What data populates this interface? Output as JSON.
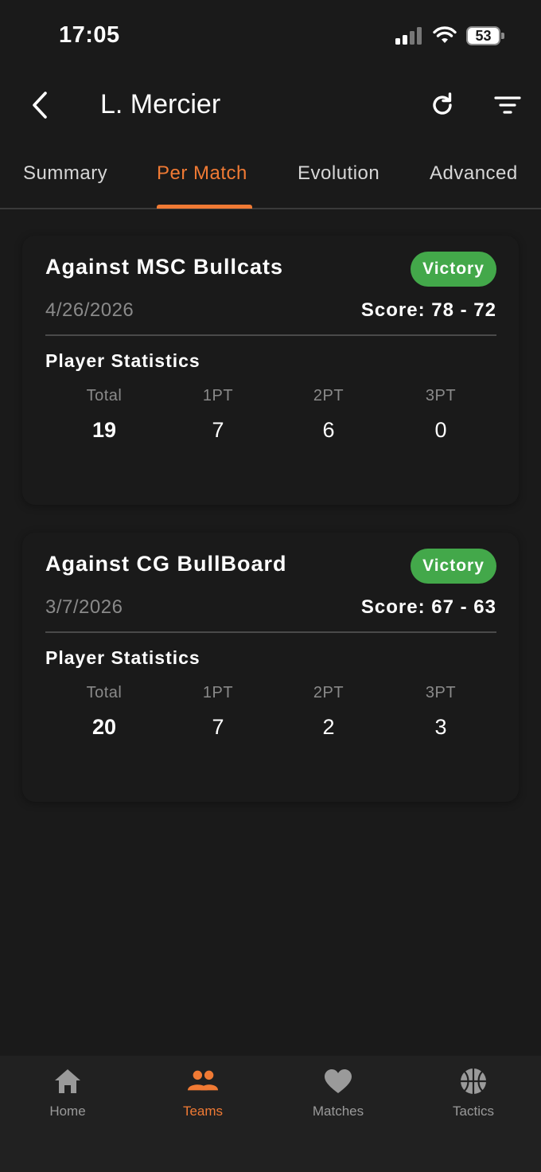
{
  "status_bar": {
    "time": "17:05",
    "battery": "53"
  },
  "header": {
    "title": "L. Mercier"
  },
  "tabs": [
    {
      "label": "Summary",
      "active": false
    },
    {
      "label": "Per Match",
      "active": true
    },
    {
      "label": "Evolution",
      "active": false
    },
    {
      "label": "Advanced",
      "active": false
    }
  ],
  "matches": [
    {
      "opponent": "Against MSC Bullcats",
      "result": "Victory",
      "date": "4/26/2026",
      "score": "Score: 78 - 72",
      "stats_title": "Player Statistics",
      "stats": [
        {
          "label": "Total",
          "value": "19"
        },
        {
          "label": "1PT",
          "value": "7"
        },
        {
          "label": "2PT",
          "value": "6"
        },
        {
          "label": "3PT",
          "value": "0"
        }
      ]
    },
    {
      "opponent": "Against CG BullBoard",
      "result": "Victory",
      "date": "3/7/2026",
      "score": "Score: 67 - 63",
      "stats_title": "Player Statistics",
      "stats": [
        {
          "label": "Total",
          "value": "20"
        },
        {
          "label": "1PT",
          "value": "7"
        },
        {
          "label": "2PT",
          "value": "2"
        },
        {
          "label": "3PT",
          "value": "3"
        }
      ]
    }
  ],
  "bottom_nav": [
    {
      "label": "Home",
      "icon": "home-icon",
      "active": false
    },
    {
      "label": "Teams",
      "icon": "teams-icon",
      "active": true
    },
    {
      "label": "Matches",
      "icon": "heart-icon",
      "active": false
    },
    {
      "label": "Tactics",
      "icon": "basketball-icon",
      "active": false
    }
  ],
  "colors": {
    "accent": "#f07a34",
    "victory": "#43a84a",
    "background": "#1a1a1a"
  }
}
